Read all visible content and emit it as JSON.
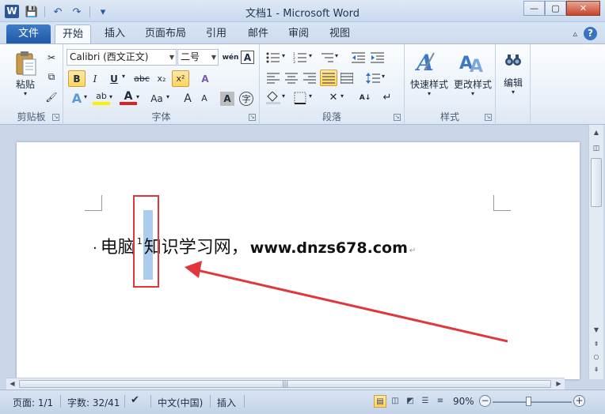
{
  "app": {
    "logo_letter": "W",
    "title": "文档1 - Microsoft Word",
    "window_buttons": {
      "minimize": "—",
      "maximize": "▢",
      "close": "✕"
    }
  },
  "qat": {
    "save_icon": "💾",
    "undo_icon": "↶",
    "redo_icon": "↷",
    "customize_icon": "▾"
  },
  "tabs": {
    "file": "文件",
    "items": [
      {
        "label": "开始",
        "active": true
      },
      {
        "label": "插入",
        "active": false
      },
      {
        "label": "页面布局",
        "active": false
      },
      {
        "label": "引用",
        "active": false
      },
      {
        "label": "邮件",
        "active": false
      },
      {
        "label": "审阅",
        "active": false
      },
      {
        "label": "视图",
        "active": false
      }
    ],
    "collapse_icon": "▵",
    "help_label": "?"
  },
  "ribbon": {
    "clipboard": {
      "label": "剪贴板",
      "paste_label": "粘贴",
      "cut_icon": "✂",
      "copy_icon": "⧉",
      "format_painter_icon": "🖌"
    },
    "font": {
      "label": "字体",
      "font_name": "Calibri (西文正文)",
      "font_size": "二号",
      "phonetic_icon": "wén",
      "char_border_label": "A",
      "bold": "B",
      "italic": "I",
      "underline": "U",
      "strikethrough": "abc",
      "subscript": "x₂",
      "superscript": "x²",
      "clear_format_icon": "A",
      "text_effect_label": "A",
      "highlight_label": "ab",
      "font_color_label": "A",
      "change_case_label": "Aa",
      "grow_font_label": "A",
      "shrink_font_label": "A",
      "char_shading_label": "A",
      "enclose_char_label": "字"
    },
    "paragraph": {
      "label": "段落"
    },
    "styles": {
      "label": "样式",
      "quick_styles": "快速样式",
      "change_styles": "更改样式"
    },
    "editing": {
      "label": "编辑"
    }
  },
  "document": {
    "bullet": "·",
    "text_before": "电脑",
    "superscript": "1",
    "text_after": "知识学习网，",
    "url": "www.dnzs678.com",
    "paragraph_mark": "↵"
  },
  "status": {
    "page": "页面: 1/1",
    "words": "字数: 32/41",
    "language": "中文(中国)",
    "insert_mode": "插入",
    "zoom": "90%",
    "zoom_minus": "−",
    "zoom_plus": "+"
  },
  "colors": {
    "highlight_box": "#e2363a",
    "selection": "#9dc3ea",
    "file_tab": "#2b66b5"
  }
}
